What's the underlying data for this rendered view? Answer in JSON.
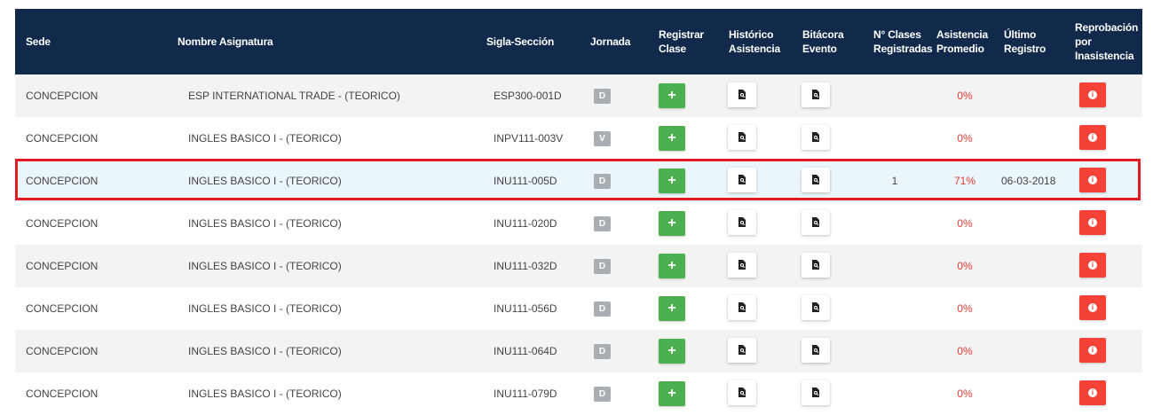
{
  "table": {
    "headers": {
      "sede": "Sede",
      "nombre": "Nombre Asignatura",
      "sigla": "Sigla-Sección",
      "jornada": "Jornada",
      "registrar_1": "Registrar",
      "registrar_2": "Clase",
      "historico_1": "Histórico",
      "historico_2": "Asistencia",
      "bitacora_1": "Bitácora",
      "bitacora_2": "Evento",
      "clases_1": "N° Clases",
      "clases_2": "Registradas",
      "asistencia_1": "Asistencia",
      "asistencia_2": "Promedio",
      "ultimo_1": "Último",
      "ultimo_2": "Registro",
      "reprobacion_1": "Reprobación",
      "reprobacion_2": "por",
      "reprobacion_3": "Inasistencia"
    },
    "rows": [
      {
        "sede": "CONCEPCION",
        "nombre": "ESP INTERNATIONAL TRADE - (TEORICO)",
        "sigla": "ESP300-001D",
        "jornada": "D",
        "registrar": "+",
        "clases": "",
        "asistencia": "0%",
        "ultimo": "",
        "info": "i"
      },
      {
        "sede": "CONCEPCION",
        "nombre": "INGLES BASICO I - (TEORICO)",
        "sigla": "INPV111-003V",
        "jornada": "V",
        "registrar": "+",
        "clases": "",
        "asistencia": "0%",
        "ultimo": "",
        "info": "i"
      },
      {
        "sede": "CONCEPCION",
        "nombre": "INGLES BASICO I - (TEORICO)",
        "sigla": "INU111-005D",
        "jornada": "D",
        "registrar": "+",
        "clases": "1",
        "asistencia": "71%",
        "ultimo": "06-03-2018",
        "info": "i"
      },
      {
        "sede": "CONCEPCION",
        "nombre": "INGLES BASICO I - (TEORICO)",
        "sigla": "INU111-020D",
        "jornada": "D",
        "registrar": "+",
        "clases": "",
        "asistencia": "0%",
        "ultimo": "",
        "info": "i"
      },
      {
        "sede": "CONCEPCION",
        "nombre": "INGLES BASICO I - (TEORICO)",
        "sigla": "INU111-032D",
        "jornada": "D",
        "registrar": "+",
        "clases": "",
        "asistencia": "0%",
        "ultimo": "",
        "info": "i"
      },
      {
        "sede": "CONCEPCION",
        "nombre": "INGLES BASICO I - (TEORICO)",
        "sigla": "INU111-056D",
        "jornada": "D",
        "registrar": "+",
        "clases": "",
        "asistencia": "0%",
        "ultimo": "",
        "info": "i"
      },
      {
        "sede": "CONCEPCION",
        "nombre": "INGLES BASICO I - (TEORICO)",
        "sigla": "INU111-064D",
        "jornada": "D",
        "registrar": "+",
        "clases": "",
        "asistencia": "0%",
        "ultimo": "",
        "info": "i"
      },
      {
        "sede": "CONCEPCION",
        "nombre": "INGLES BASICO I - (TEORICO)",
        "sigla": "INU111-079D",
        "jornada": "D",
        "registrar": "+",
        "clases": "",
        "asistencia": "0%",
        "ultimo": "",
        "info": "i"
      }
    ]
  },
  "colors": {
    "header_bg": "#11294b",
    "add_green": "#4caf50",
    "info_red": "#f44336",
    "percent_red": "#e53935",
    "highlight_border": "#e21b23"
  },
  "icons": {
    "registrar": "plus-icon",
    "historico": "document-search-icon",
    "bitacora": "document-search-icon",
    "reprobacion": "info-circle-icon"
  }
}
